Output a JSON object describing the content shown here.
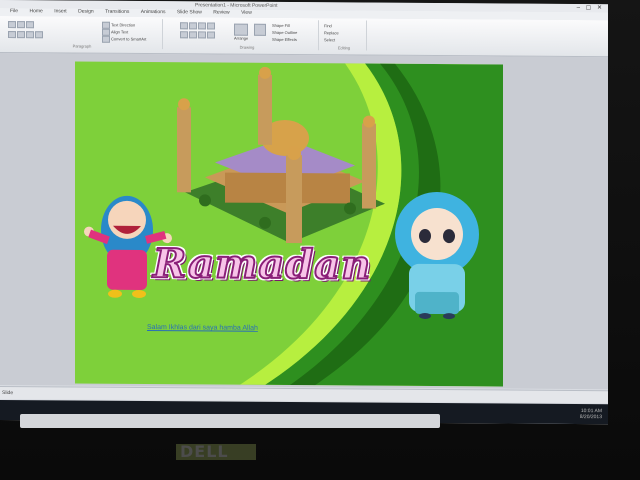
{
  "window": {
    "title": "Presentation1 - Microsoft PowerPoint",
    "controls": "– ▢ ✕"
  },
  "ribbon": {
    "tabs": [
      "File",
      "Home",
      "Insert",
      "Design",
      "Transitions",
      "Animations",
      "Slide Show",
      "Review",
      "View"
    ],
    "groups": {
      "paragraph_label": "Paragraph",
      "drawing_label": "Drawing",
      "editing_label": "Editing"
    },
    "buttons": {
      "text_direction": "Text Direction",
      "align_text": "Align Text",
      "convert_smartart": "Convert to SmartArt",
      "arrange": "Arrange",
      "quick_styles": "Quick Styles",
      "shape_fill": "Shape Fill",
      "shape_outline": "Shape Outline",
      "shape_effects": "Shape Effects",
      "find": "Find",
      "replace": "Replace",
      "select": "Select"
    }
  },
  "slide": {
    "headline": "Ramadan",
    "caption": "Salam Ikhlas dari saya hamba Allah"
  },
  "statusbar": {
    "text": "Slide"
  },
  "taskbar": {
    "time": "10:01 AM",
    "date": "8/20/2013"
  },
  "monitor": {
    "brand": "DELL"
  },
  "colors": {
    "slide_bg": "#7ed03a",
    "dark_band": "#2e8f1f",
    "caption": "#2a6fb8",
    "headline_stroke": "#8a1f78"
  }
}
